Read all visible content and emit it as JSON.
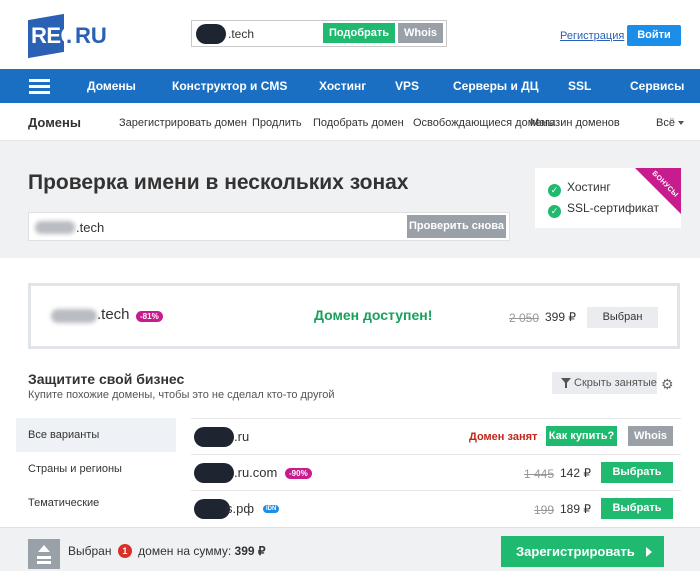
{
  "header": {
    "logo_main": "REG",
    "logo_dot": ".",
    "logo_suffix": "RU",
    "search_suffix": ".tech",
    "pick_label": "Подобрать",
    "whois_label": "Whois",
    "register_link": "Регистрация",
    "login_label": "Войти"
  },
  "nav": {
    "items": [
      "Домены",
      "Конструктор и CMS",
      "Хостинг",
      "VPS",
      "Серверы и ДЦ",
      "SSL",
      "Сервисы"
    ]
  },
  "subnav": {
    "title": "Домены",
    "items": [
      "Зарегистрировать домен",
      "Продлить",
      "Подобрать домен",
      "Освобождающиеся домены",
      "Магазин доменов",
      "Всё"
    ]
  },
  "hero": {
    "title": "Проверка имени в нескольких зонах",
    "input_suffix": ".tech",
    "check_label": "Проверить снова"
  },
  "bonus": {
    "items": [
      "Хостинг",
      "SSL-сертификат"
    ],
    "ribbon": "БОНУСЫ"
  },
  "result": {
    "domain_suffix": ".tech",
    "discount": "-81%",
    "status": "Домен доступен!",
    "old_price": "2 050",
    "new_price": "399 ₽",
    "chosen_label": "Выбран"
  },
  "protect": {
    "title": "Защитите свой бизнес",
    "subtitle": "Купите похожие домены, чтобы это не сделал кто-то другой",
    "filter_label": "Скрыть занятые"
  },
  "categories": [
    "Все варианты",
    "Страны и регионы",
    "Тематические"
  ],
  "rows": [
    {
      "suffix": ".ru",
      "taken": "Домен занят",
      "how_label": "Как купить?",
      "whois_label": "Whois"
    },
    {
      "suffix": ".ru.com",
      "discount": "-90%",
      "old_price": "1 445",
      "new_price": "142 ₽",
      "choose_label": "Выбрать"
    },
    {
      "suffix": "s.рф",
      "idn": "IDN",
      "old_price": "199",
      "new_price": "189 ₽",
      "choose_label": "Выбрать"
    }
  ],
  "footer": {
    "selected_label": "Выбран",
    "count": "1",
    "sum_label": "домен на сумму:",
    "sum_value": "399 ₽",
    "register_label": "Зарегистрировать"
  },
  "colors": {
    "brand_blue": "#2a61b5",
    "nav_blue": "#1a6fc2",
    "green": "#1fba6f",
    "magenta": "#c71c8e",
    "red": "#c0261b"
  }
}
